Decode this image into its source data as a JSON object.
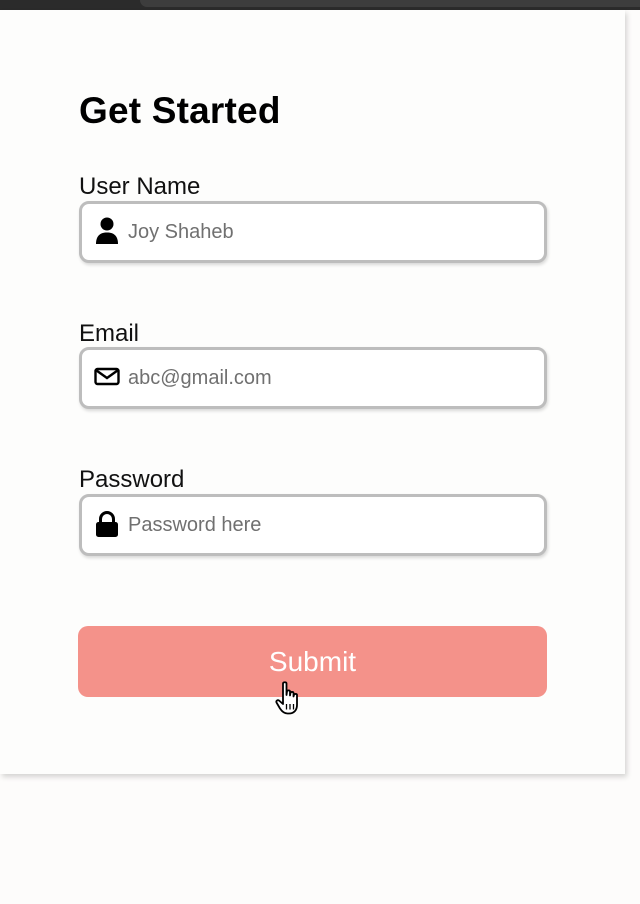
{
  "form": {
    "title": "Get Started",
    "fields": [
      {
        "label": "User Name",
        "placeholder": "Joy Shaheb",
        "icon": "user-icon"
      },
      {
        "label": "Email",
        "placeholder": "abc@gmail.com",
        "icon": "envelope-icon"
      },
      {
        "label": "Password",
        "placeholder": "Password here",
        "icon": "lock-icon"
      }
    ],
    "submit_label": "Submit"
  },
  "colors": {
    "submit_background": "#f4928a",
    "input_border": "#bdbdbd",
    "page_background": "#fdfcfb"
  }
}
